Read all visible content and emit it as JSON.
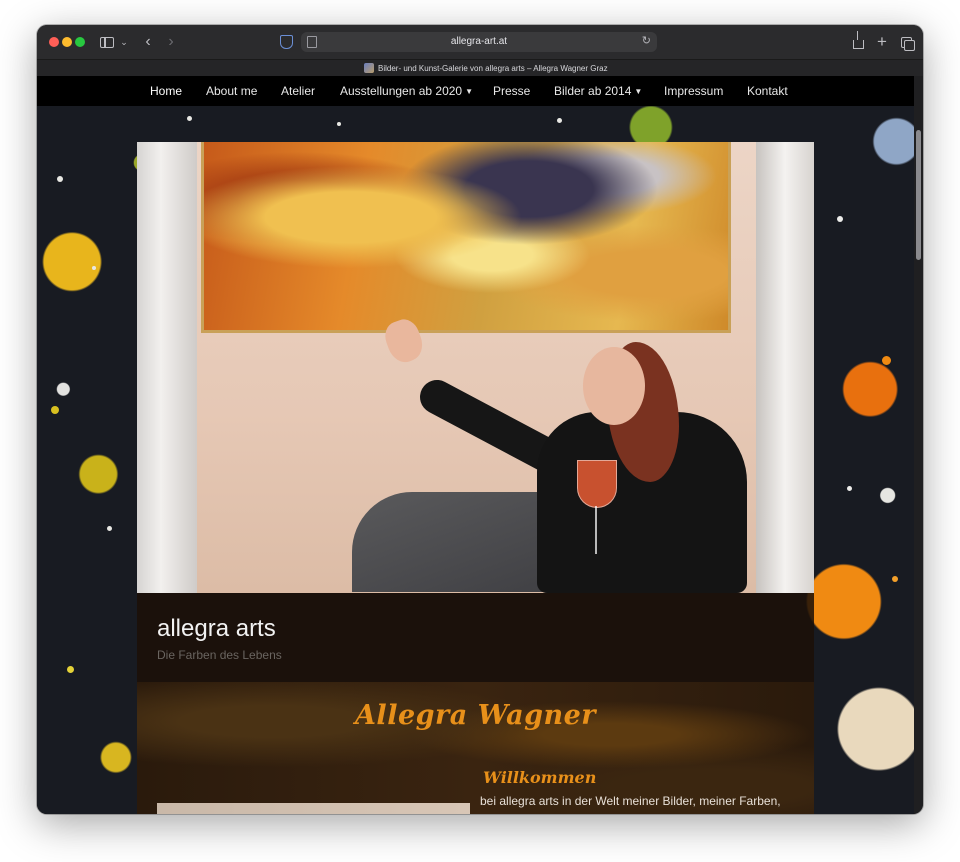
{
  "browser": {
    "address": "allegra-art.at",
    "tab_title": "Bilder- und Kunst-Galerie von allegra arts – Allegra Wagner Graz",
    "icons": [
      "sidebar-icon",
      "chevron-down-icon",
      "back-icon",
      "forward-icon",
      "shield-icon",
      "page-icon",
      "reload-icon",
      "share-icon",
      "plus-icon",
      "tabs-icon"
    ]
  },
  "nav": {
    "items": [
      {
        "label": "Home"
      },
      {
        "label": "About me"
      },
      {
        "label": "Atelier"
      },
      {
        "label": "Ausstellungen ab 2020"
      },
      {
        "label": "Presse"
      },
      {
        "label": "Bilder ab 2014"
      },
      {
        "label": "Impressum"
      },
      {
        "label": "Kontakt"
      }
    ],
    "active": "Home"
  },
  "site": {
    "title": "allegra arts",
    "tagline": "Die Farben des Lebens"
  },
  "content": {
    "heading": "Allegra Wagner",
    "welcome_heading": "Willkommen",
    "welcome_text": "bei allegra arts in der Welt meiner Bilder, meiner Farben,"
  },
  "colors": {
    "accent": "#e8901a",
    "nav_bg": "#000000",
    "header_bg": "#1c1008"
  }
}
